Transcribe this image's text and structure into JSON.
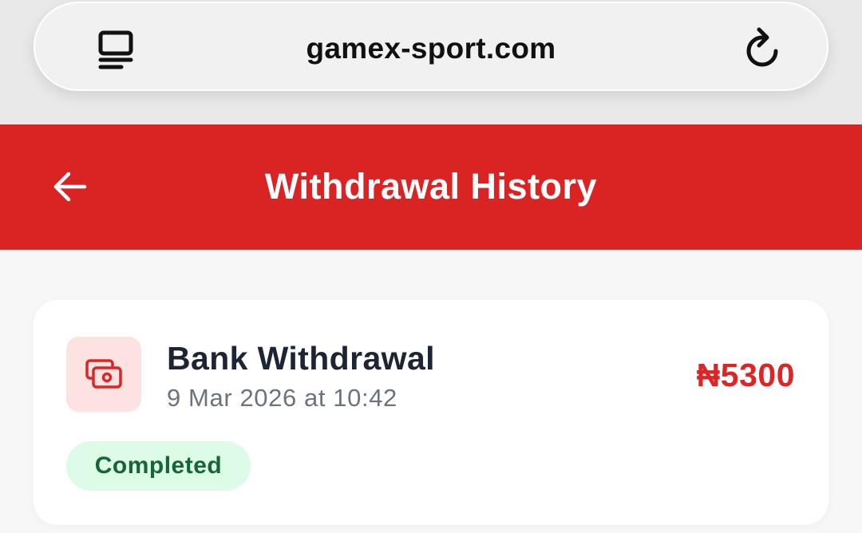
{
  "browser": {
    "url": "gamex-sport.com",
    "tabs_icon": "tabs-icon",
    "reload_icon": "reload-icon"
  },
  "header": {
    "title": "Withdrawal History",
    "back_icon": "arrow-left-icon",
    "color": "#da2424"
  },
  "withdrawals": [
    {
      "icon": "cash-icon",
      "title": "Bank Withdrawal",
      "date": "9 Mar 2026 at 10:42",
      "amount": "₦5300",
      "status": "Completed",
      "amount_color": "#dc2626",
      "status_color": "#166534"
    }
  ]
}
